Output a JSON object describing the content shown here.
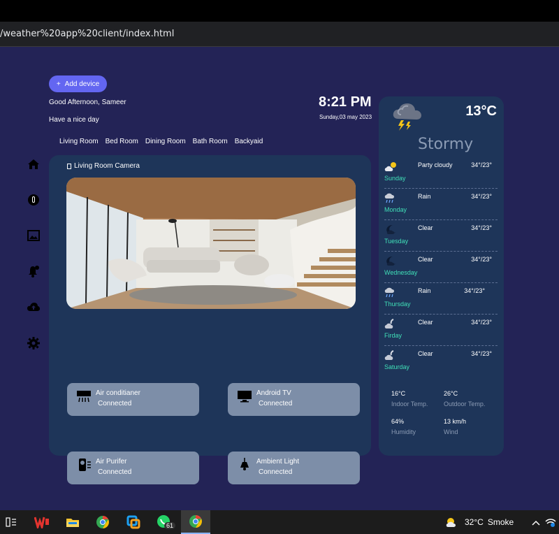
{
  "browser": {
    "url": "/weather%20app%20client/index.html"
  },
  "header": {
    "add_device_label": "Add device",
    "add_icon": "+",
    "greeting": "Good Afternoon, Sameer",
    "subtitle": "Have a nice day",
    "time": "8:21 PM",
    "date": "Sunday,03 may 2023"
  },
  "rooms": [
    "Living Room",
    "Bed Room",
    "Dining Room",
    "Bath Room",
    "Backyaid"
  ],
  "sidebar": {
    "icons": [
      "home-icon",
      "power-icon",
      "image-icon",
      "bell-icon",
      "cloud-icon",
      "settings-icon"
    ]
  },
  "camera": {
    "title": "Living Room Camera"
  },
  "devices": [
    {
      "name": "Air conditianer",
      "status": "Connected",
      "icon": "air-conditioner-icon"
    },
    {
      "name": "Android TV",
      "status": "Connected",
      "icon": "tv-icon"
    },
    {
      "name": "Air Purifer",
      "status": "Connected",
      "icon": "air-purifier-icon"
    },
    {
      "name": "Ambient Light",
      "status": "Connected",
      "icon": "lamp-icon"
    }
  ],
  "weather": {
    "temperature": "13°C",
    "condition": "Stormy",
    "icon": "storm-icon",
    "forecast": [
      {
        "day": "Sunday",
        "desc": "Party cloudy",
        "temp": "34°/23°",
        "icon": "partly-cloudy-icon"
      },
      {
        "day": "Monday",
        "desc": "Rain",
        "temp": "34°/23°",
        "icon": "rain-icon"
      },
      {
        "day": "Tuesday",
        "desc": "Clear",
        "temp": "34°/23°",
        "icon": "clear-night-icon"
      },
      {
        "day": "Wednesday",
        "desc": "Clear",
        "temp": "34°/23°",
        "icon": "clear-night-icon"
      },
      {
        "day": "Thursday",
        "desc": "Rain",
        "temp": "34°/23°",
        "icon": "rain-icon"
      },
      {
        "day": "Firday",
        "desc": "Clear",
        "temp": "34°/23°",
        "icon": "cloudy-night-icon"
      },
      {
        "day": "Saturday",
        "desc": "Clear",
        "temp": "34°/23°",
        "icon": "cloudy-night-icon"
      }
    ],
    "stats": {
      "indoor_value": "16°C",
      "indoor_label": "Indoor Temp.",
      "outdoor_value": "26°C",
      "outdoor_label": "Outdoor Temp.",
      "humidity_value": "64%",
      "humidity_label": "Humidity",
      "wind_value": "13 km/h",
      "wind_label": "Wind"
    }
  },
  "taskbar": {
    "weather_temp": "32°C",
    "weather_desc": "Smoke",
    "whatsapp_badge": "61"
  },
  "colors": {
    "page_bg": "#232356",
    "panel_bg": "#1e3559",
    "accent": "#6366f1",
    "device_card": "#7d8ea8",
    "forecast_day": "#40e0b8"
  }
}
